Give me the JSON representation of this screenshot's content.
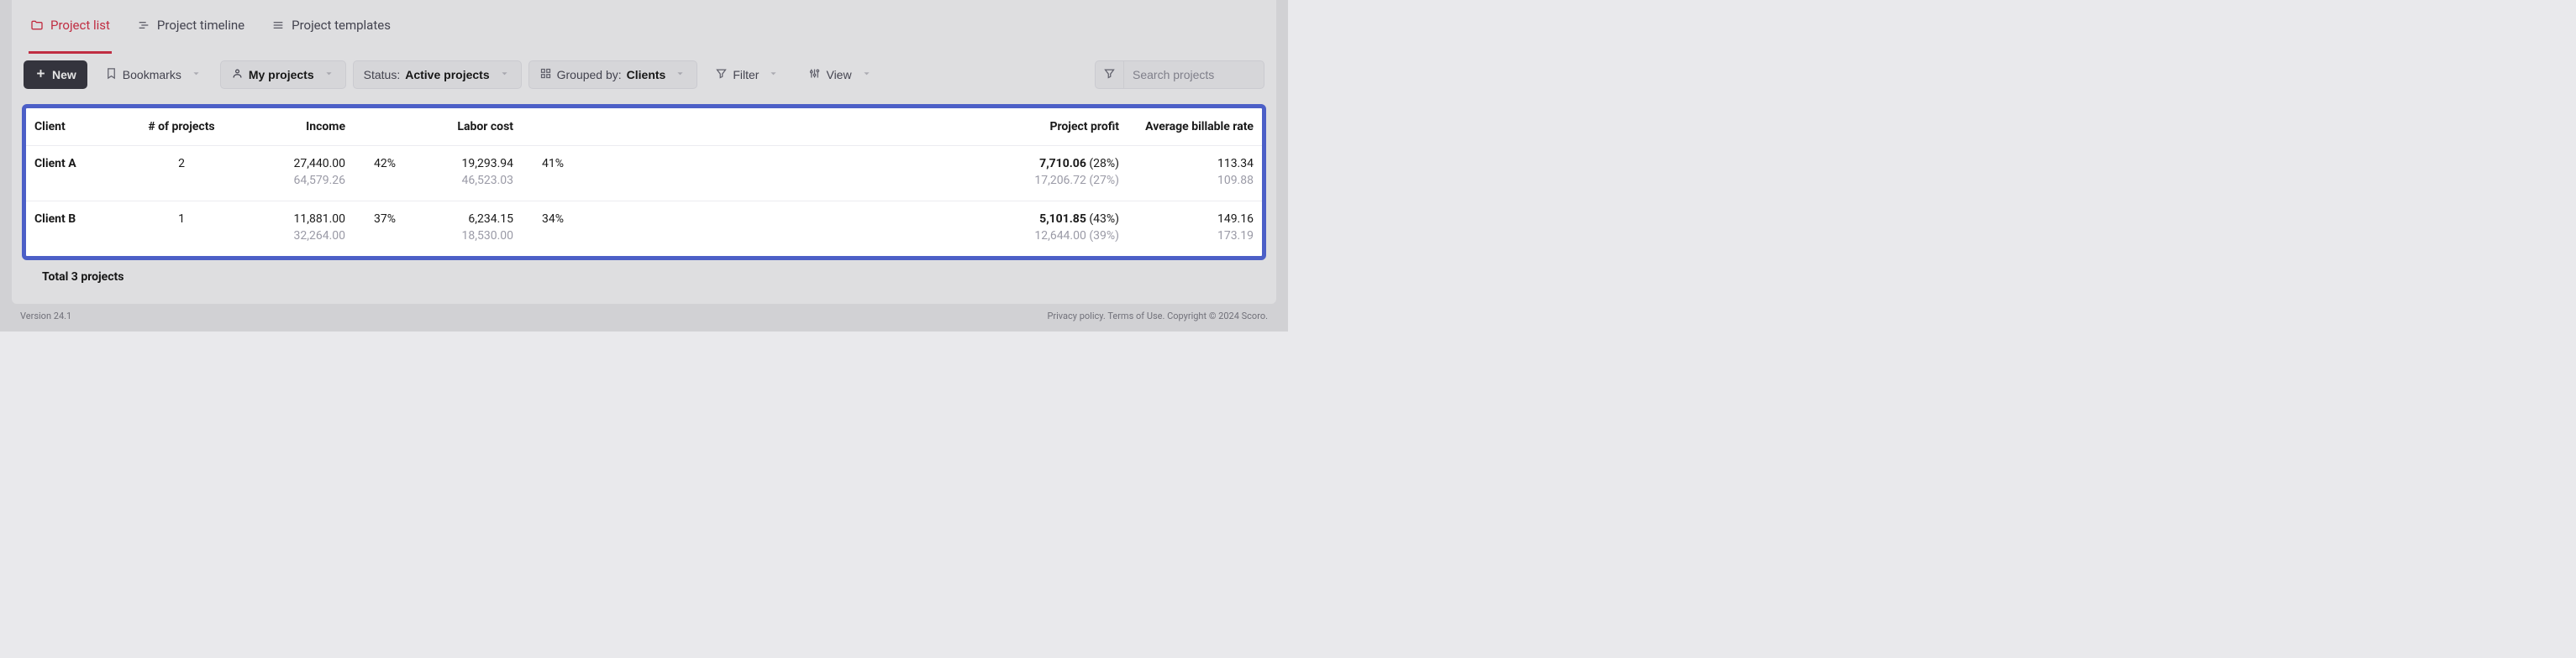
{
  "tabs": [
    {
      "label": "Project list",
      "active": true
    },
    {
      "label": "Project timeline",
      "active": false
    },
    {
      "label": "Project templates",
      "active": false
    }
  ],
  "toolbar": {
    "new_label": "New",
    "bookmarks_label": "Bookmarks",
    "my_projects_label": "My projects",
    "status_prefix": "Status:",
    "status_value": "Active projects",
    "grouped_prefix": "Grouped by:",
    "grouped_value": "Clients",
    "filter_label": "Filter",
    "view_label": "View",
    "search_placeholder": "Search projects"
  },
  "columns": {
    "client": "Client",
    "num_projects": "# of projects",
    "income": "Income",
    "labor_cost": "Labor cost",
    "project_profit": "Project profit",
    "avg_billable_rate": "Average billable rate"
  },
  "rows": [
    {
      "client": "Client A",
      "num_projects": "2",
      "income_main": "27,440.00",
      "income_sec": "64,579.26",
      "income_pct": "42%",
      "labor_main": "19,293.94",
      "labor_sec": "46,523.03",
      "labor_pct": "41%",
      "profit_main": "7,710.06",
      "profit_main_pct": "(28%)",
      "profit_sec": "17,206.72",
      "profit_sec_pct": "(27%)",
      "rate_main": "113.34",
      "rate_sec": "109.88"
    },
    {
      "client": "Client B",
      "num_projects": "1",
      "income_main": "11,881.00",
      "income_sec": "32,264.00",
      "income_pct": "37%",
      "labor_main": "6,234.15",
      "labor_sec": "18,530.00",
      "labor_pct": "34%",
      "profit_main": "5,101.85",
      "profit_main_pct": "(43%)",
      "profit_sec": "12,644.00",
      "profit_sec_pct": "(39%)",
      "rate_main": "149.16",
      "rate_sec": "173.19"
    }
  ],
  "totals_label": "Total 3 projects",
  "footer": {
    "version": "Version 24.1",
    "privacy": "Privacy policy.",
    "terms": "Terms of Use.",
    "copyright": "Copyright © 2024 Scoro."
  }
}
